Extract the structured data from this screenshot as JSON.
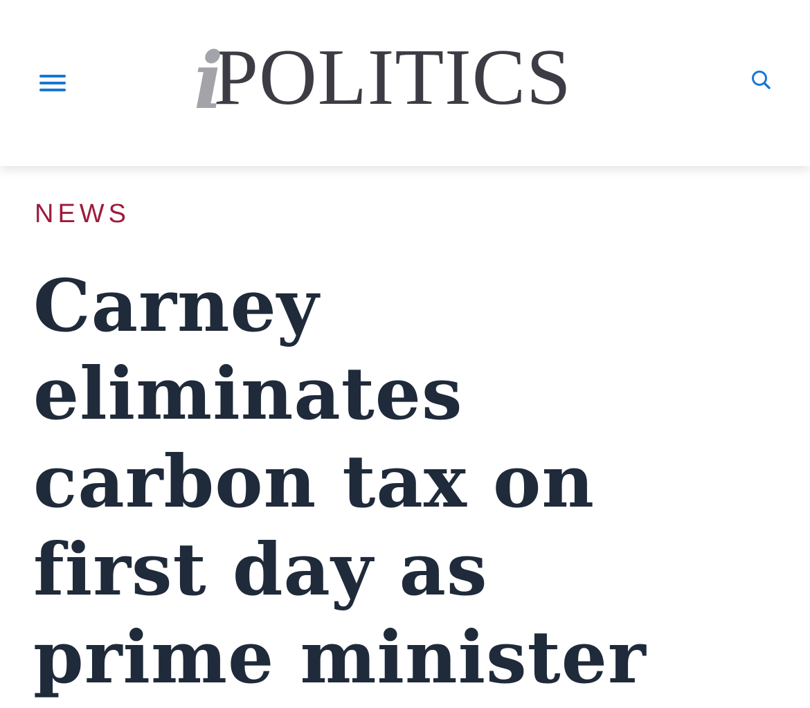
{
  "header": {
    "logo_prefix": "i",
    "logo_text": "POLITICS",
    "menu_icon": "hamburger-menu-icon",
    "search_icon": "search-icon"
  },
  "article": {
    "category": "NEWS",
    "headline": "Carney eliminates carbon tax on first day as prime minister"
  },
  "colors": {
    "accent_blue": "#1877d4",
    "category_red": "#9e1b3b",
    "headline_text": "#1f2a3a",
    "logo_dark": "#3d3c45",
    "logo_gray": "#a3a3aa"
  }
}
